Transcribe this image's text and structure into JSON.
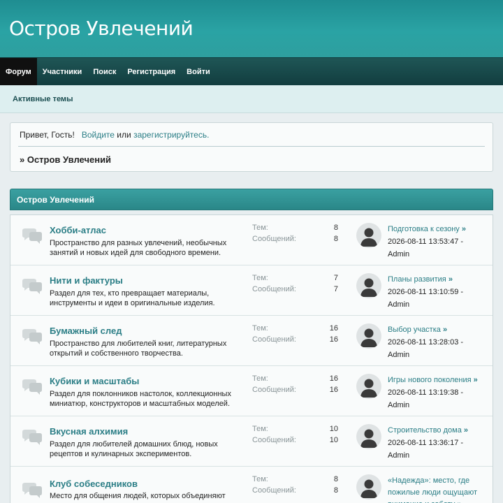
{
  "site": {
    "title": "Остров Увлечений"
  },
  "nav": {
    "items": [
      {
        "label": "Форум"
      },
      {
        "label": "Участники"
      },
      {
        "label": "Поиск"
      },
      {
        "label": "Регистрация"
      },
      {
        "label": "Войти"
      }
    ]
  },
  "subnav": {
    "active_topics": "Активные темы"
  },
  "info": {
    "greeting_prefix": "Привет, Гость!",
    "login_link": "Войдите",
    "or": "или",
    "register_link": "зарегистрируйтесь.",
    "breadcrumb": "» Остров Увлечений"
  },
  "category": {
    "title": "Остров Увлечений"
  },
  "labels": {
    "topics": "Тем:",
    "posts": "Сообщений:",
    "raquo": "»"
  },
  "boards": [
    {
      "name": "Хобби-атлас",
      "desc": "Пространство для разных увлечений, необычных занятий и новых идей для свободного времени.",
      "topics": "8",
      "posts": "8",
      "last_topic": "Подготовка к сезону",
      "last_date": "2026-08-11 13:53:47 -",
      "last_user": "Admin"
    },
    {
      "name": "Нити и фактуры",
      "desc": "Раздел для тех, кто превращает материалы, инструменты и идеи в оригинальные изделия.",
      "topics": "7",
      "posts": "7",
      "last_topic": "Планы развития",
      "last_date": "2026-08-11 13:10:59 -",
      "last_user": "Admin"
    },
    {
      "name": "Бумажный след",
      "desc": "Пространство для любителей книг, литературных открытий и собственного творчества.",
      "topics": "16",
      "posts": "16",
      "last_topic": "Выбор участка",
      "last_date": "2026-08-11 13:28:03 -",
      "last_user": "Admin"
    },
    {
      "name": "Кубики и масштабы",
      "desc": "Раздел для поклонников настолок, коллекционных миниатюр, конструкторов и масштабных моделей.",
      "topics": "16",
      "posts": "16",
      "last_topic": "Игры нового поколения",
      "last_date": "2026-08-11 13:19:38 -",
      "last_user": "Admin"
    },
    {
      "name": "Вкусная алхимия",
      "desc": "Раздел для любителей домашних блюд, новых рецептов и кулинарных экспериментов.",
      "topics": "10",
      "posts": "10",
      "last_topic": "Строительство дома",
      "last_date": "2026-08-11 13:36:17 -",
      "last_user": "Admin"
    },
    {
      "name": "Клуб собеседников",
      "desc": "Место для общения людей, которых объединяют",
      "topics": "8",
      "posts": "8",
      "last_topic": "«Надежда»: место, где пожилые люди ощущают внимание и заботу",
      "last_date": "",
      "last_user": ""
    }
  ]
}
